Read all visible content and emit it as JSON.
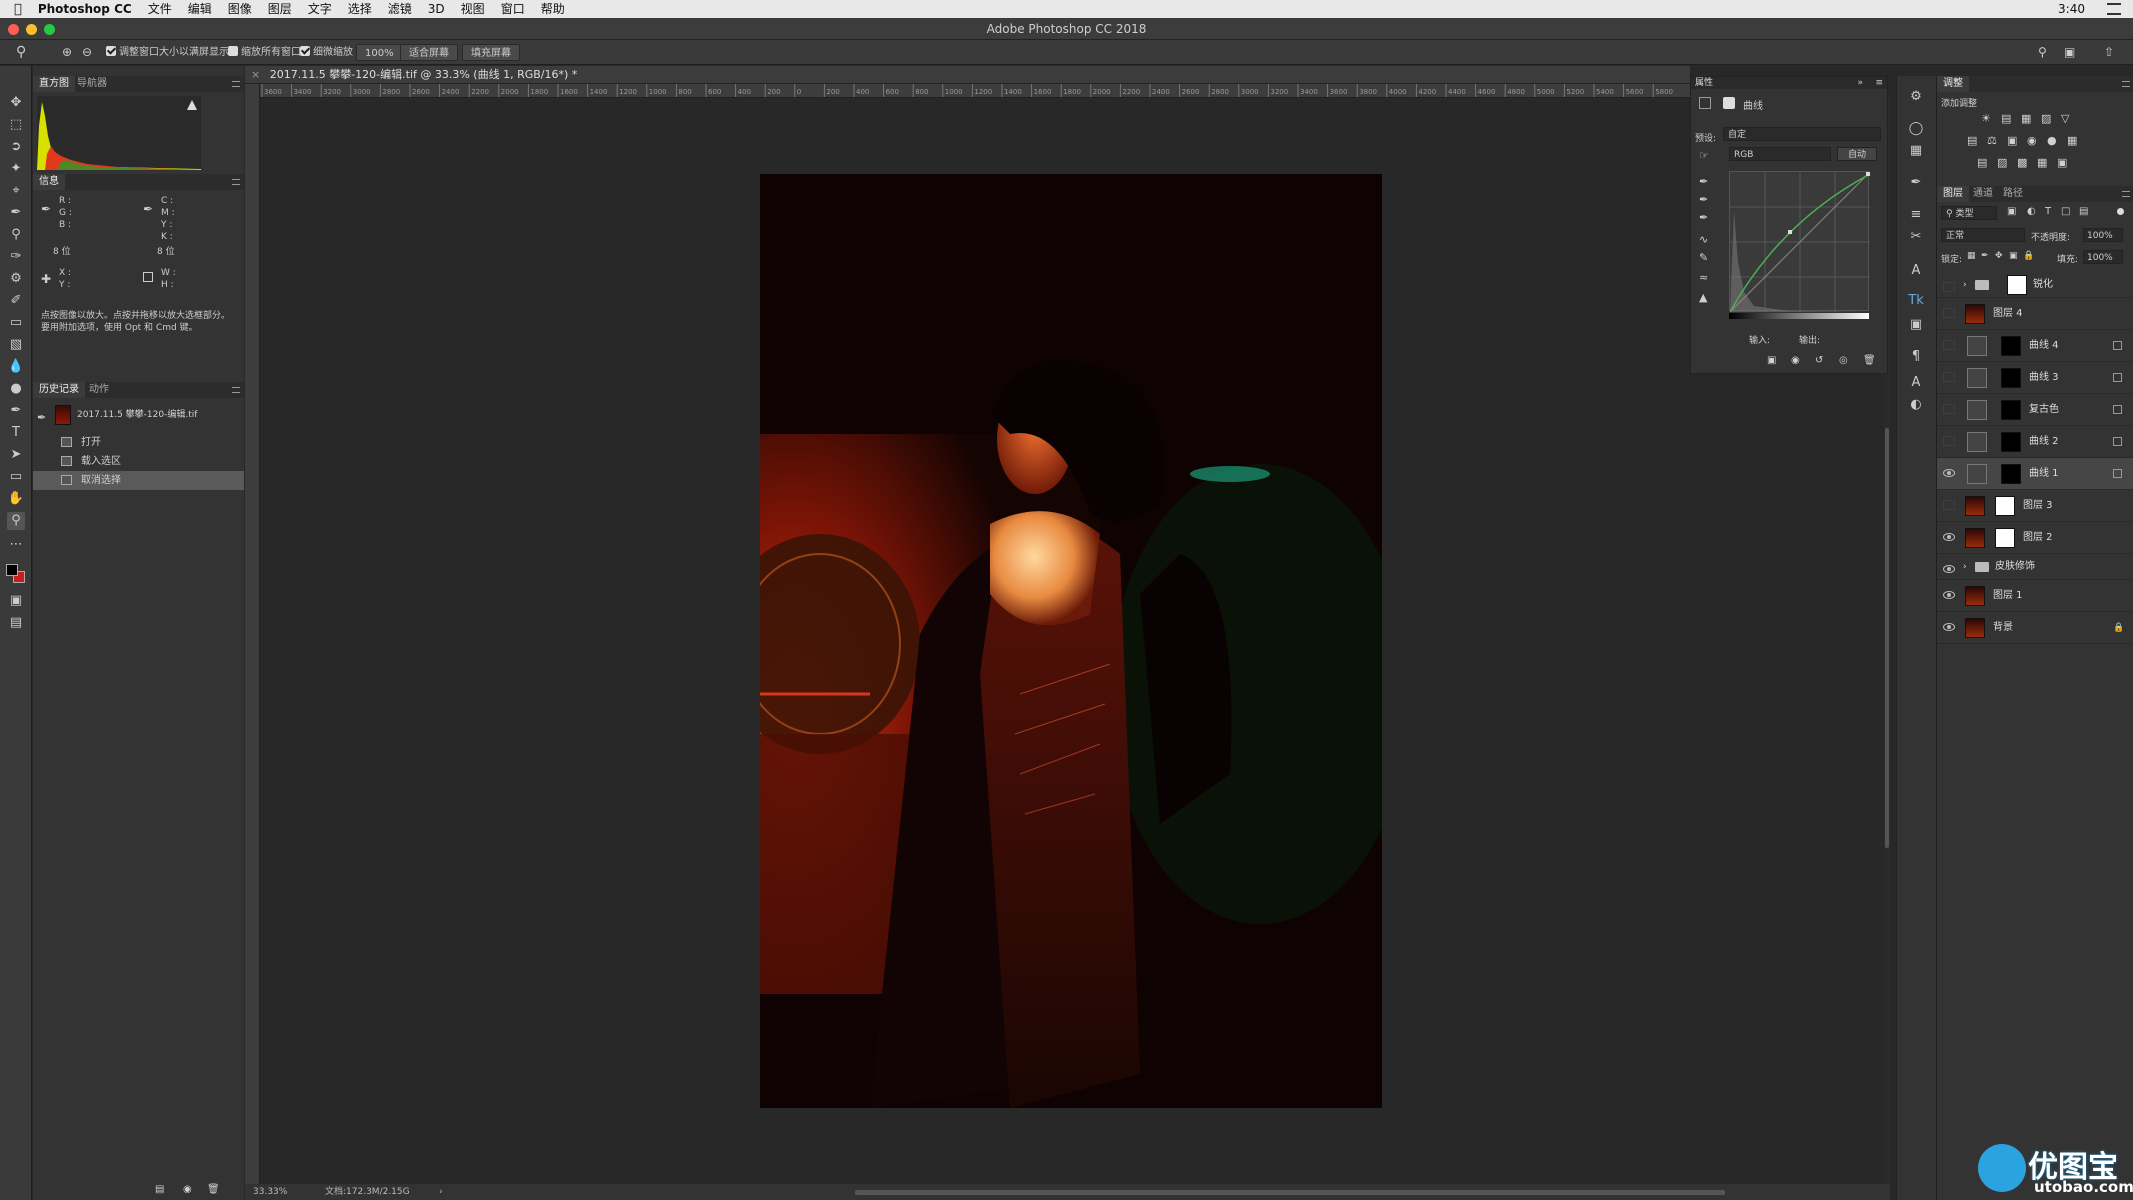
{
  "menubar": {
    "app_name": "Photoshop CC",
    "items": [
      "文件",
      "编辑",
      "图像",
      "图层",
      "文字",
      "选择",
      "滤镜",
      "3D",
      "视图",
      "窗口",
      "帮助"
    ],
    "clock": "3:40"
  },
  "window": {
    "title": "Adobe Photoshop CC 2018"
  },
  "options": {
    "resize_windows_label": "调整窗口大小以满屏显示",
    "zoom_all_label": "缩放所有窗口",
    "scrubby_zoom_label": "细微缩放",
    "zoom_value": "100%",
    "fit_screen_label": "适合屏幕",
    "fill_screen_label": "填充屏幕"
  },
  "document": {
    "tab_title": "2017.11.5 攀攀-120-编辑.tif @ 33.3% (曲线 1, RGB/16*) *",
    "zoom_status": "33.33%",
    "doc_size": "文档:172.3M/2.15G",
    "ruler_ticks": [
      "3600",
      "3400",
      "3200",
      "3000",
      "2800",
      "2600",
      "2400",
      "2200",
      "2000",
      "1800",
      "1600",
      "1400",
      "1200",
      "1000",
      "800",
      "600",
      "400",
      "200",
      "0",
      "200",
      "400",
      "600",
      "800",
      "1000",
      "1200",
      "1400",
      "1600",
      "1800",
      "2000",
      "2200",
      "2400",
      "2600",
      "2800",
      "3000",
      "3200",
      "3400",
      "3600",
      "3800",
      "4000",
      "4200",
      "4400",
      "4600",
      "4800",
      "5000",
      "5200",
      "5400",
      "5600",
      "5800"
    ]
  },
  "left_panels": {
    "histogram_tabs": [
      "直方图",
      "导航器"
    ],
    "info_tab": "信息",
    "info_rgb": [
      "R :",
      "G :",
      "B :"
    ],
    "info_cmyk": [
      "C :",
      "M :",
      "Y :",
      "K :"
    ],
    "bit_depth_a": "8 位",
    "bit_depth_b": "8 位",
    "info_xy": [
      "X :",
      "Y :"
    ],
    "info_wh": [
      "W :",
      "H :"
    ],
    "help_text": "点按图像以放大。点按并拖移以放大选框部分。要用附加选项，使用 Opt 和 Cmd 键。",
    "history_tabs": [
      "历史记录",
      "动作"
    ],
    "history_snapshot": "2017.11.5 攀攀-120-编辑.tif",
    "history_items": [
      "打开",
      "载入选区",
      "取消选择"
    ]
  },
  "properties": {
    "panel_title": "属性",
    "type_label": "曲线",
    "preset_label": "预设:",
    "preset_value": "自定",
    "channel_value": "RGB",
    "auto_label": "自动",
    "input_label": "输入:",
    "output_label": "输出:"
  },
  "adjustments": {
    "panel_title": "调整",
    "add_label": "添加调整"
  },
  "layers_panel": {
    "tabs": [
      "图层",
      "通道",
      "路径"
    ],
    "kind_label": "类型",
    "blend_mode": "正常",
    "opacity_label": "不透明度:",
    "opacity_value": "100%",
    "lock_label": "锁定:",
    "fill_label": "填充:",
    "fill_value": "100%",
    "layers": [
      {
        "name": "锐化",
        "kind": "group",
        "visible": false
      },
      {
        "name": "图层 4",
        "kind": "pixel",
        "visible": false
      },
      {
        "name": "曲线 4",
        "kind": "adjust",
        "visible": false
      },
      {
        "name": "曲线 3",
        "kind": "adjust",
        "visible": false
      },
      {
        "name": "复古色",
        "kind": "adjust",
        "visible": false
      },
      {
        "name": "曲线 2",
        "kind": "adjust",
        "visible": false
      },
      {
        "name": "曲线 1",
        "kind": "adjust",
        "visible": true,
        "selected": true
      },
      {
        "name": "图层 3",
        "kind": "pixel",
        "visible": false
      },
      {
        "name": "图层 2",
        "kind": "pixel",
        "visible": true
      },
      {
        "name": "皮肤修饰",
        "kind": "group",
        "visible": true
      },
      {
        "name": "图层 1",
        "kind": "pixel",
        "visible": true
      },
      {
        "name": "背景",
        "kind": "pixel",
        "visible": true
      }
    ]
  },
  "watermark": {
    "text": "优图宝",
    "url": "utobao.com"
  },
  "colors": {
    "accent_select": "#464646",
    "foreground": "#000000",
    "background": "#c81e1e",
    "curve_green": "#4caf50"
  }
}
